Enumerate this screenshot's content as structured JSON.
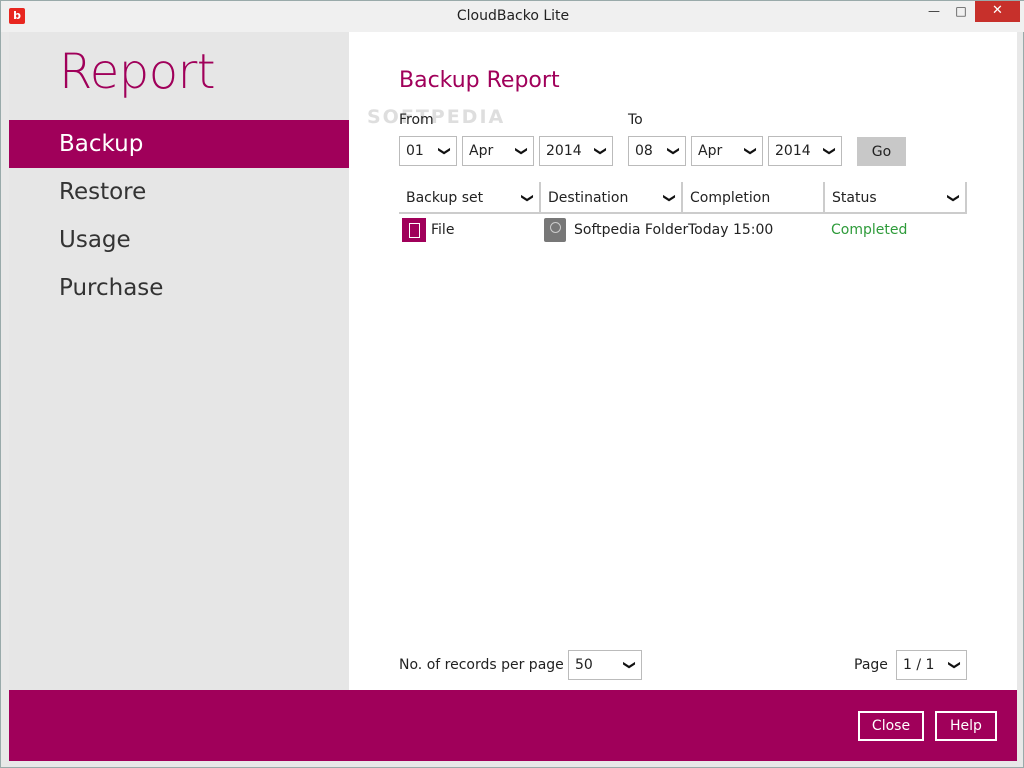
{
  "window": {
    "title": "CloudBacko Lite",
    "logo_glyph": "b"
  },
  "sidebar": {
    "title": "Report",
    "items": [
      {
        "label": "Backup",
        "active": true
      },
      {
        "label": "Restore",
        "active": false
      },
      {
        "label": "Usage",
        "active": false
      },
      {
        "label": "Purchase",
        "active": false
      }
    ]
  },
  "main": {
    "title": "Backup Report",
    "from_label": "From",
    "to_label": "To",
    "from": {
      "day": "01",
      "month": "Apr",
      "year": "2014"
    },
    "to": {
      "day": "08",
      "month": "Apr",
      "year": "2014"
    },
    "go_label": "Go",
    "table": {
      "columns": [
        "Backup set",
        "Destination",
        "Completion",
        "Status"
      ],
      "rows": [
        {
          "backup_set": "File",
          "destination": "Softpedia Folder",
          "completion": "Today 15:00",
          "status": "Completed"
        }
      ]
    },
    "records_label": "No. of records per page",
    "records_value": "50",
    "page_label": "Page",
    "page_value": "1 / 1"
  },
  "footer": {
    "close_label": "Close",
    "help_label": "Help"
  },
  "watermark": "SOFTPEDIA",
  "colors": {
    "accent": "#a0005a",
    "status_ok": "#2e9b3a",
    "close_red": "#c7302b"
  },
  "icons": {
    "chevron": "chevron-down-icon",
    "file": "file-icon",
    "drive": "drive-icon"
  }
}
